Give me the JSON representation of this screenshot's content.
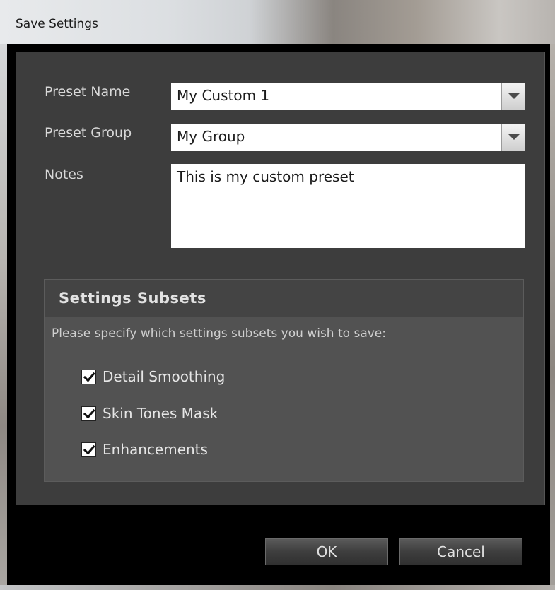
{
  "window": {
    "title": "Save Settings"
  },
  "form": {
    "preset_name_label": "Preset Name",
    "preset_name_value": "My Custom 1",
    "preset_group_label": "Preset Group",
    "preset_group_value": "My Group",
    "notes_label": "Notes",
    "notes_value": "This is my custom preset"
  },
  "subsets": {
    "title": "Settings Subsets",
    "description": "Please specify which settings subsets you wish to save:",
    "items": [
      {
        "label": "Detail Smoothing",
        "checked": true
      },
      {
        "label": "Skin Tones Mask",
        "checked": true
      },
      {
        "label": "Enhancements",
        "checked": true
      }
    ]
  },
  "buttons": {
    "ok": "OK",
    "cancel": "Cancel"
  },
  "icons": {
    "dropdown": "chevron-down-icon",
    "check": "checkmark-icon"
  }
}
